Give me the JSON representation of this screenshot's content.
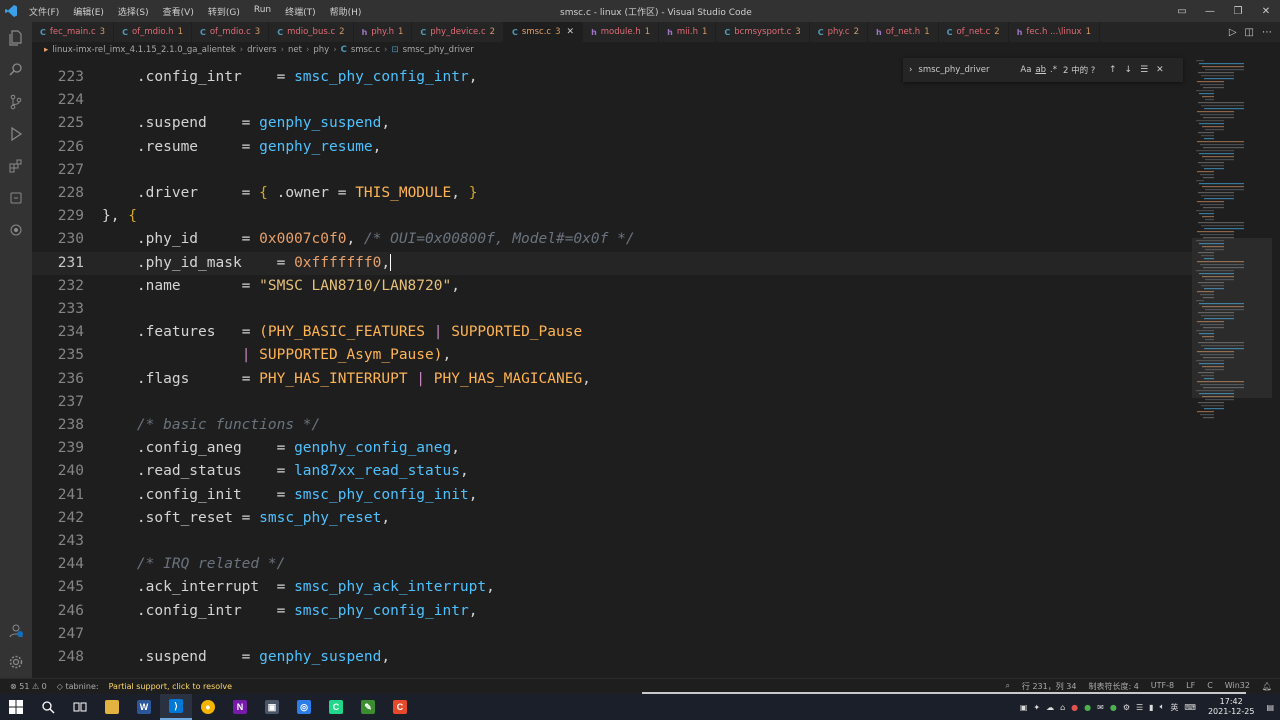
{
  "titlebar": {
    "menu": [
      "文件(F)",
      "编辑(E)",
      "选择(S)",
      "查看(V)",
      "转到(G)",
      "Run",
      "终端(T)",
      "帮助(H)"
    ],
    "window_title": "smsc.c - linux (工作区) - Visual Studio Code"
  },
  "tabs": [
    {
      "icon": "C",
      "label": "fec_main.c",
      "count": "3",
      "active": false
    },
    {
      "icon": "C",
      "label": "of_mdio.h",
      "count": "1",
      "active": false
    },
    {
      "icon": "C",
      "label": "of_mdio.c",
      "count": "3",
      "active": false
    },
    {
      "icon": "C",
      "label": "mdio_bus.c",
      "count": "2",
      "active": false
    },
    {
      "icon": "h",
      "label": "phy.h",
      "count": "1",
      "active": false
    },
    {
      "icon": "C",
      "label": "phy_device.c",
      "count": "2",
      "active": false
    },
    {
      "icon": "C",
      "label": "smsc.c",
      "count": "3",
      "active": true
    },
    {
      "icon": "h",
      "label": "module.h",
      "count": "1",
      "active": false
    },
    {
      "icon": "h",
      "label": "mii.h",
      "count": "1",
      "active": false
    },
    {
      "icon": "C",
      "label": "bcmsysport.c",
      "count": "3",
      "active": false
    },
    {
      "icon": "C",
      "label": "phy.c",
      "count": "2",
      "active": false
    },
    {
      "icon": "h",
      "label": "of_net.h",
      "count": "1",
      "active": false
    },
    {
      "icon": "C",
      "label": "of_net.c",
      "count": "2",
      "active": false
    },
    {
      "icon": "h",
      "label": "fec.h ...\\linux",
      "count": "1",
      "active": false
    }
  ],
  "breadcrumb": [
    "linux-imx-rel_imx_4.1.15_2.1.0_ga_alientek",
    "drivers",
    "net",
    "phy",
    "smsc.c",
    "smsc_phy_driver"
  ],
  "find_widget": {
    "query": "smsc_phy_driver",
    "options": [
      "Aa",
      "ab",
      ".*"
    ],
    "result": "2 中的 ?"
  },
  "editor": {
    "current_line": "231",
    "lines": [
      {
        "n": "223",
        "tokens": [
          [
            "t-field",
            "    .config_intr"
          ],
          [
            "t-op",
            "    = "
          ],
          [
            "t-fn",
            "smsc_phy_config_intr"
          ],
          [
            "t-punct",
            ","
          ]
        ]
      },
      {
        "n": "224",
        "tokens": []
      },
      {
        "n": "225",
        "tokens": [
          [
            "t-field",
            "    .suspend"
          ],
          [
            "t-op",
            "    = "
          ],
          [
            "t-fn",
            "genphy_suspend"
          ],
          [
            "t-punct",
            ","
          ]
        ]
      },
      {
        "n": "226",
        "tokens": [
          [
            "t-field",
            "    .resume"
          ],
          [
            "t-op",
            "     = "
          ],
          [
            "t-fn",
            "genphy_resume"
          ],
          [
            "t-punct",
            ","
          ]
        ]
      },
      {
        "n": "227",
        "tokens": []
      },
      {
        "n": "228",
        "tokens": [
          [
            "t-field",
            "    .driver"
          ],
          [
            "t-op",
            "     = "
          ],
          [
            "t-brace",
            "{"
          ],
          [
            "t-field",
            " .owner = "
          ],
          [
            "t-macro",
            "THIS_MODULE"
          ],
          [
            "t-punct",
            ", "
          ],
          [
            "t-brace",
            "}"
          ]
        ]
      },
      {
        "n": "229",
        "tokens": [
          [
            "t-punct",
            "}, "
          ],
          [
            "t-brace",
            "{"
          ]
        ]
      },
      {
        "n": "230",
        "tokens": [
          [
            "t-field",
            "    .phy_id"
          ],
          [
            "t-op",
            "     = "
          ],
          [
            "t-num",
            "0x0007c0f0"
          ],
          [
            "t-punct",
            ", "
          ],
          [
            "t-com",
            "/* OUI=0x00800f, Model#=0x0f */"
          ]
        ]
      },
      {
        "n": "231",
        "tokens": [
          [
            "t-field",
            "    .phy_id_mask"
          ],
          [
            "t-op",
            "    = "
          ],
          [
            "t-num",
            "0xfffffff0"
          ],
          [
            "t-punct",
            ","
          ]
        ]
      },
      {
        "n": "232",
        "tokens": [
          [
            "t-field",
            "    .name"
          ],
          [
            "t-op",
            "       = "
          ],
          [
            "t-str",
            "\"SMSC LAN8710/LAN8720\""
          ],
          [
            "t-punct",
            ","
          ]
        ]
      },
      {
        "n": "233",
        "tokens": []
      },
      {
        "n": "234",
        "tokens": [
          [
            "t-field",
            "    .features"
          ],
          [
            "t-op",
            "   = "
          ],
          [
            "t-macro",
            "(PHY_BASIC_FEATURES "
          ],
          [
            "t-pipe",
            "| "
          ],
          [
            "t-macro",
            "SUPPORTED_Pause"
          ]
        ]
      },
      {
        "n": "235",
        "tokens": [
          [
            "t-field",
            "                "
          ],
          [
            "t-pipe",
            "| "
          ],
          [
            "t-macro",
            "SUPPORTED_Asym_Pause"
          ],
          [
            "t-macro",
            ")"
          ],
          [
            "t-punct",
            ","
          ]
        ]
      },
      {
        "n": "236",
        "tokens": [
          [
            "t-field",
            "    .flags"
          ],
          [
            "t-op",
            "      = "
          ],
          [
            "t-macro",
            "PHY_HAS_INTERRUPT "
          ],
          [
            "t-pipe",
            "| "
          ],
          [
            "t-macro",
            "PHY_HAS_MAGICANEG"
          ],
          [
            "t-punct",
            ","
          ]
        ]
      },
      {
        "n": "237",
        "tokens": []
      },
      {
        "n": "238",
        "tokens": [
          [
            "t-com",
            "    /* basic functions */"
          ]
        ]
      },
      {
        "n": "239",
        "tokens": [
          [
            "t-field",
            "    .config_aneg"
          ],
          [
            "t-op",
            "    = "
          ],
          [
            "t-fn",
            "genphy_config_aneg"
          ],
          [
            "t-punct",
            ","
          ]
        ]
      },
      {
        "n": "240",
        "tokens": [
          [
            "t-field",
            "    .read_status"
          ],
          [
            "t-op",
            "    = "
          ],
          [
            "t-fn",
            "lan87xx_read_status"
          ],
          [
            "t-punct",
            ","
          ]
        ]
      },
      {
        "n": "241",
        "tokens": [
          [
            "t-field",
            "    .config_init"
          ],
          [
            "t-op",
            "    = "
          ],
          [
            "t-fn",
            "smsc_phy_config_init"
          ],
          [
            "t-punct",
            ","
          ]
        ]
      },
      {
        "n": "242",
        "tokens": [
          [
            "t-field",
            "    .soft_reset"
          ],
          [
            "t-op",
            " = "
          ],
          [
            "t-fn",
            "smsc_phy_reset"
          ],
          [
            "t-punct",
            ","
          ]
        ]
      },
      {
        "n": "243",
        "tokens": []
      },
      {
        "n": "244",
        "tokens": [
          [
            "t-com",
            "    /* IRQ related */"
          ]
        ]
      },
      {
        "n": "245",
        "tokens": [
          [
            "t-field",
            "    .ack_interrupt"
          ],
          [
            "t-op",
            "  = "
          ],
          [
            "t-fn",
            "smsc_phy_ack_interrupt"
          ],
          [
            "t-punct",
            ","
          ]
        ]
      },
      {
        "n": "246",
        "tokens": [
          [
            "t-field",
            "    .config_intr"
          ],
          [
            "t-op",
            "    = "
          ],
          [
            "t-fn",
            "smsc_phy_config_intr"
          ],
          [
            "t-punct",
            ","
          ]
        ]
      },
      {
        "n": "247",
        "tokens": []
      },
      {
        "n": "248",
        "tokens": [
          [
            "t-field",
            "    .suspend"
          ],
          [
            "t-op",
            "    = "
          ],
          [
            "t-fn",
            "genphy_suspend"
          ],
          [
            "t-punct",
            ","
          ]
        ]
      }
    ]
  },
  "statusbar": {
    "problems": "⊗ 51 ⚠ 0",
    "tabnine": "◇ tabnine:",
    "warning": "Partial support, click to resolve",
    "position": "行 231，列 34",
    "tab_size": "制表符长度: 4",
    "encoding": "UTF-8",
    "eol": "LF",
    "language": "C",
    "platform": "Win32"
  },
  "taskbar": {
    "time": "17:42",
    "date": "2021-12-25",
    "ime": "英"
  },
  "colors": {
    "editor_bg": "#1e1e1e",
    "function": "#4fc1ff",
    "number": "#e8a06b",
    "macro": "#ffb454",
    "comment": "#6a737d"
  }
}
